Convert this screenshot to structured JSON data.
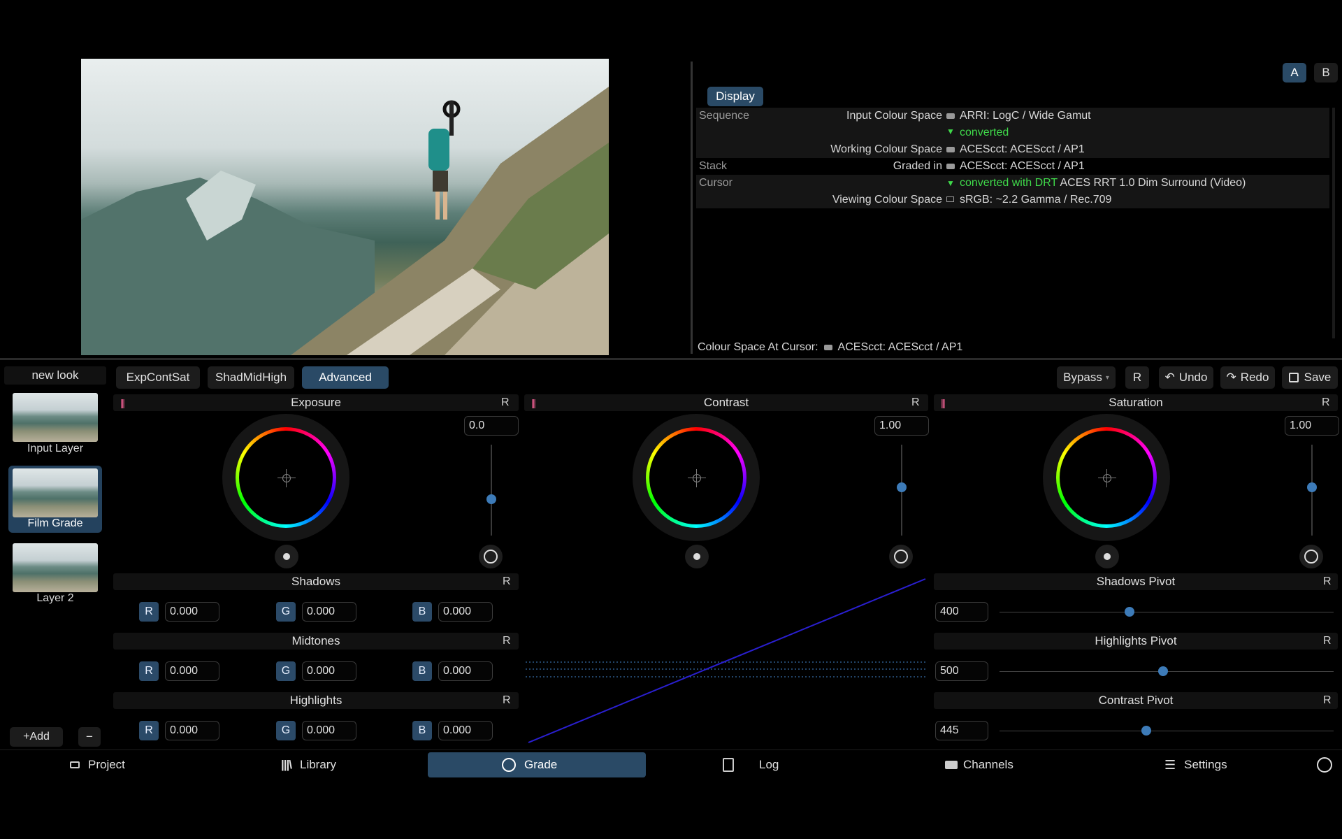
{
  "ab_buttons": [
    "A",
    "B"
  ],
  "display_panel": {
    "tab": "Display",
    "rows": [
      {
        "section": "Sequence",
        "label": "Input Colour Space",
        "icon": "camera-icon",
        "value": "ARRI: LogC / Wide Gamut",
        "value_green": "",
        "value_prefix_green": ""
      },
      {
        "section": "",
        "label": "",
        "icon": "",
        "value": "",
        "value_green": "converted",
        "value_prefix_green": ""
      },
      {
        "section": "",
        "label": "Working Colour Space",
        "icon": "camera-icon",
        "value": "ACEScct: ACEScct / AP1",
        "value_green": "",
        "value_prefix_green": ""
      },
      {
        "section": "Stack",
        "label": "Graded in",
        "icon": "camera-icon",
        "value": "ACEScct: ACEScct / AP1",
        "value_green": "",
        "value_prefix_green": ""
      },
      {
        "section": "Cursor",
        "label": "",
        "icon": "",
        "value": "ACES RRT 1.0 Dim Surround (Video)",
        "value_green": "",
        "value_prefix_green": "converted with DRT"
      },
      {
        "section": "",
        "label": "Viewing Colour Space",
        "icon": "monitor-icon",
        "value": "sRGB: ~2.2 Gamma / Rec.709",
        "value_green": "",
        "value_prefix_green": ""
      }
    ],
    "footer_label": "Colour Space At Cursor:",
    "footer_value": "ACEScct: ACEScct / AP1"
  },
  "layers": {
    "title": "new look",
    "items": [
      {
        "label": "Input Layer",
        "selected": false
      },
      {
        "label": "Film Grade",
        "selected": true
      },
      {
        "label": "Layer 2",
        "selected": false
      }
    ],
    "add_label": "+Add",
    "remove_label": "−"
  },
  "grade_tabs": [
    "ExpContSat",
    "ShadMidHigh",
    "Advanced"
  ],
  "active_grade_tab": "Advanced",
  "toolbar": {
    "bypass": "Bypass",
    "reset": "R",
    "undo": "Undo",
    "redo": "Redo",
    "save": "Save"
  },
  "wheels": [
    {
      "title": "Exposure",
      "reset": "R",
      "value": "0.0",
      "slider_level": 0.6
    },
    {
      "title": "Contrast",
      "reset": "R",
      "value": "1.00",
      "slider_level": 0.47
    },
    {
      "title": "Saturation",
      "reset": "R",
      "value": "1.00",
      "slider_level": 0.47
    }
  ],
  "rgb_groups": [
    {
      "title": "Shadows",
      "reset": "R",
      "r": "0.000",
      "g": "0.000",
      "b": "0.000"
    },
    {
      "title": "Midtones",
      "reset": "R",
      "r": "0.000",
      "g": "0.000",
      "b": "0.000"
    },
    {
      "title": "Highlights",
      "reset": "R",
      "r": "0.000",
      "g": "0.000",
      "b": "0.000"
    }
  ],
  "channel_labels": [
    "R",
    "G",
    "B"
  ],
  "pivots": [
    {
      "title": "Shadows Pivot",
      "reset": "R",
      "value": "400",
      "level": 0.39
    },
    {
      "title": "Highlights Pivot",
      "reset": "R",
      "value": "500",
      "level": 0.49
    },
    {
      "title": "Contrast Pivot",
      "reset": "R",
      "value": "445",
      "level": 0.44
    }
  ],
  "nav": [
    {
      "label": "Project",
      "icon": "folder-icon"
    },
    {
      "label": "Library",
      "icon": "library-icon"
    },
    {
      "label": "Grade",
      "icon": "grade-icon"
    },
    {
      "label": "Log",
      "icon": "log-icon"
    },
    {
      "label": "Channels",
      "icon": "camera-icon"
    },
    {
      "label": "Settings",
      "icon": "sliders-icon"
    }
  ],
  "active_nav": "Grade",
  "colors": {
    "accent": "#2a4a66",
    "knob": "#3d7bb8",
    "green": "#3fd94a",
    "curve": "#2a1fd0"
  }
}
